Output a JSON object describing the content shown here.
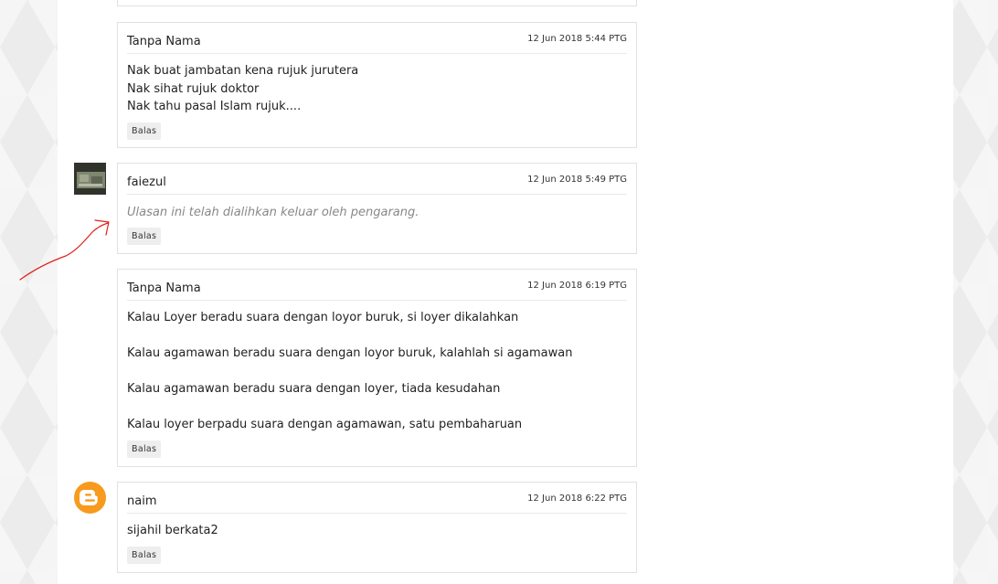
{
  "comments": [
    {
      "author": "Tanpa Nama",
      "timestamp": "12 Jun 2018 5:44 PTG",
      "lines": [
        "Nak buat jambatan kena rujuk jurutera",
        "Nak sihat rujuk doktor",
        "Nak tahu pasal Islam rujuk...."
      ],
      "reply_label": "Balas"
    },
    {
      "author": "faiezul",
      "timestamp": "12 Jun 2018 5:49 PTG",
      "deleted_text": "Ulasan ini telah dialihkan keluar oleh pengarang.",
      "reply_label": "Balas"
    },
    {
      "author": "Tanpa Nama",
      "timestamp": "12 Jun 2018 6:19 PTG",
      "lines": [
        "Kalau Loyer beradu suara dengan loyor buruk, si loyer dikalahkan",
        "",
        "Kalau agamawan beradu suara dengan loyor buruk, kalahlah si agamawan",
        "",
        "Kalau agamawan beradu suara dengan loyer, tiada kesudahan",
        "",
        "Kalau loyer berpadu suara dengan agamawan, satu pembaharuan"
      ],
      "reply_label": "Balas"
    },
    {
      "author": "naim",
      "timestamp": "12 Jun 2018 6:22 PTG",
      "lines": [
        "sijahil berkata2"
      ],
      "reply_label": "Balas"
    }
  ],
  "colors": {
    "annotation_arrow": "#e0201b",
    "blogger_orange": "#f79a1e"
  },
  "icons": {
    "faiezul_avatar": "user-photo-avatar",
    "naim_avatar": "blogger-logo-icon"
  }
}
